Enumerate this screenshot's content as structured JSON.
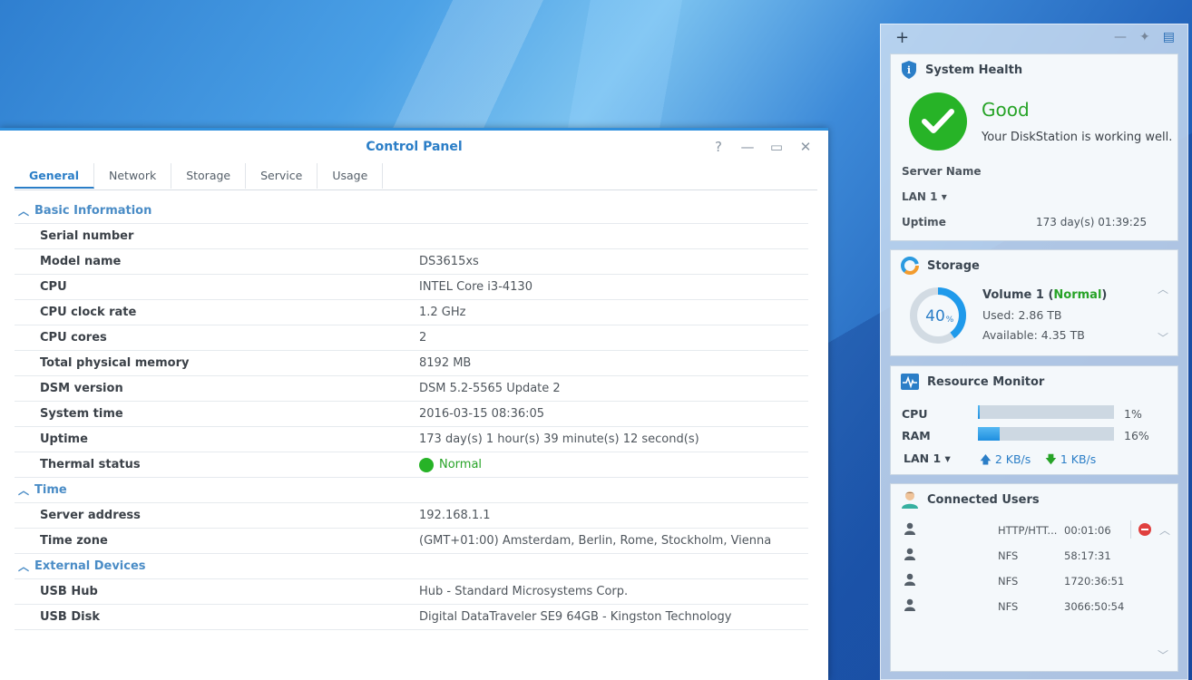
{
  "control_panel": {
    "title": "Control Panel",
    "tabs": [
      {
        "label": "General",
        "active": true
      },
      {
        "label": "Network",
        "active": false
      },
      {
        "label": "Storage",
        "active": false
      },
      {
        "label": "Service",
        "active": false
      },
      {
        "label": "Usage",
        "active": false
      }
    ],
    "sections": {
      "basic": {
        "title": "Basic Information",
        "rows": [
          {
            "key": "Serial number",
            "value": ""
          },
          {
            "key": "Model name",
            "value": "DS3615xs"
          },
          {
            "key": "CPU",
            "value": "INTEL Core i3-4130"
          },
          {
            "key": "CPU clock rate",
            "value": "1.2 GHz"
          },
          {
            "key": "CPU cores",
            "value": "2"
          },
          {
            "key": "Total physical memory",
            "value": "8192 MB"
          },
          {
            "key": "DSM version",
            "value": "DSM 5.2-5565 Update 2"
          },
          {
            "key": "System time",
            "value": "2016-03-15 08:36:05"
          },
          {
            "key": "Uptime",
            "value": "173 day(s) 1 hour(s) 39 minute(s) 12 second(s)"
          },
          {
            "key": "Thermal status",
            "value": "Normal"
          }
        ]
      },
      "time": {
        "title": "Time",
        "rows": [
          {
            "key": "Server address",
            "value": "192.168.1.1"
          },
          {
            "key": "Time zone",
            "value": "(GMT+01:00) Amsterdam, Berlin, Rome, Stockholm, Vienna"
          }
        ]
      },
      "external": {
        "title": "External Devices",
        "rows": [
          {
            "key": "USB Hub",
            "value": "Hub - Standard Microsystems Corp."
          },
          {
            "key": "USB Disk",
            "value": "Digital DataTraveler SE9 64GB - Kingston Technology"
          }
        ]
      }
    }
  },
  "widgets": {
    "system_health": {
      "title": "System Health",
      "status": "Good",
      "message": "Your DiskStation is working well.",
      "server_name_label": "Server Name",
      "lan_label": "LAN 1",
      "uptime_label": "Uptime",
      "uptime_value": "173 day(s) 01:39:25"
    },
    "storage": {
      "title": "Storage",
      "percent": 40,
      "percent_text": "40",
      "percent_unit": "%",
      "volume_name": "Volume 1",
      "volume_status": "Normal",
      "used": "Used: 2.86 TB",
      "available": "Available: 4.35 TB"
    },
    "resource_monitor": {
      "title": "Resource Monitor",
      "cpu_label": "CPU",
      "cpu_percent": 1,
      "cpu_text": "1%",
      "ram_label": "RAM",
      "ram_percent": 16,
      "ram_text": "16%",
      "lan_label": "LAN 1",
      "upload": "2 KB/s",
      "download": "1 KB/s"
    },
    "connected_users": {
      "title": "Connected Users",
      "users": [
        {
          "protocol": "HTTP/HTT...",
          "time": "00:01:06"
        },
        {
          "protocol": "NFS",
          "time": "58:17:31"
        },
        {
          "protocol": "NFS",
          "time": "1720:36:51"
        },
        {
          "protocol": "NFS",
          "time": "3066:50:54"
        }
      ]
    }
  },
  "colors": {
    "accent": "#2b7ec7",
    "good": "#27b327",
    "bar": "#1f8fe0"
  }
}
